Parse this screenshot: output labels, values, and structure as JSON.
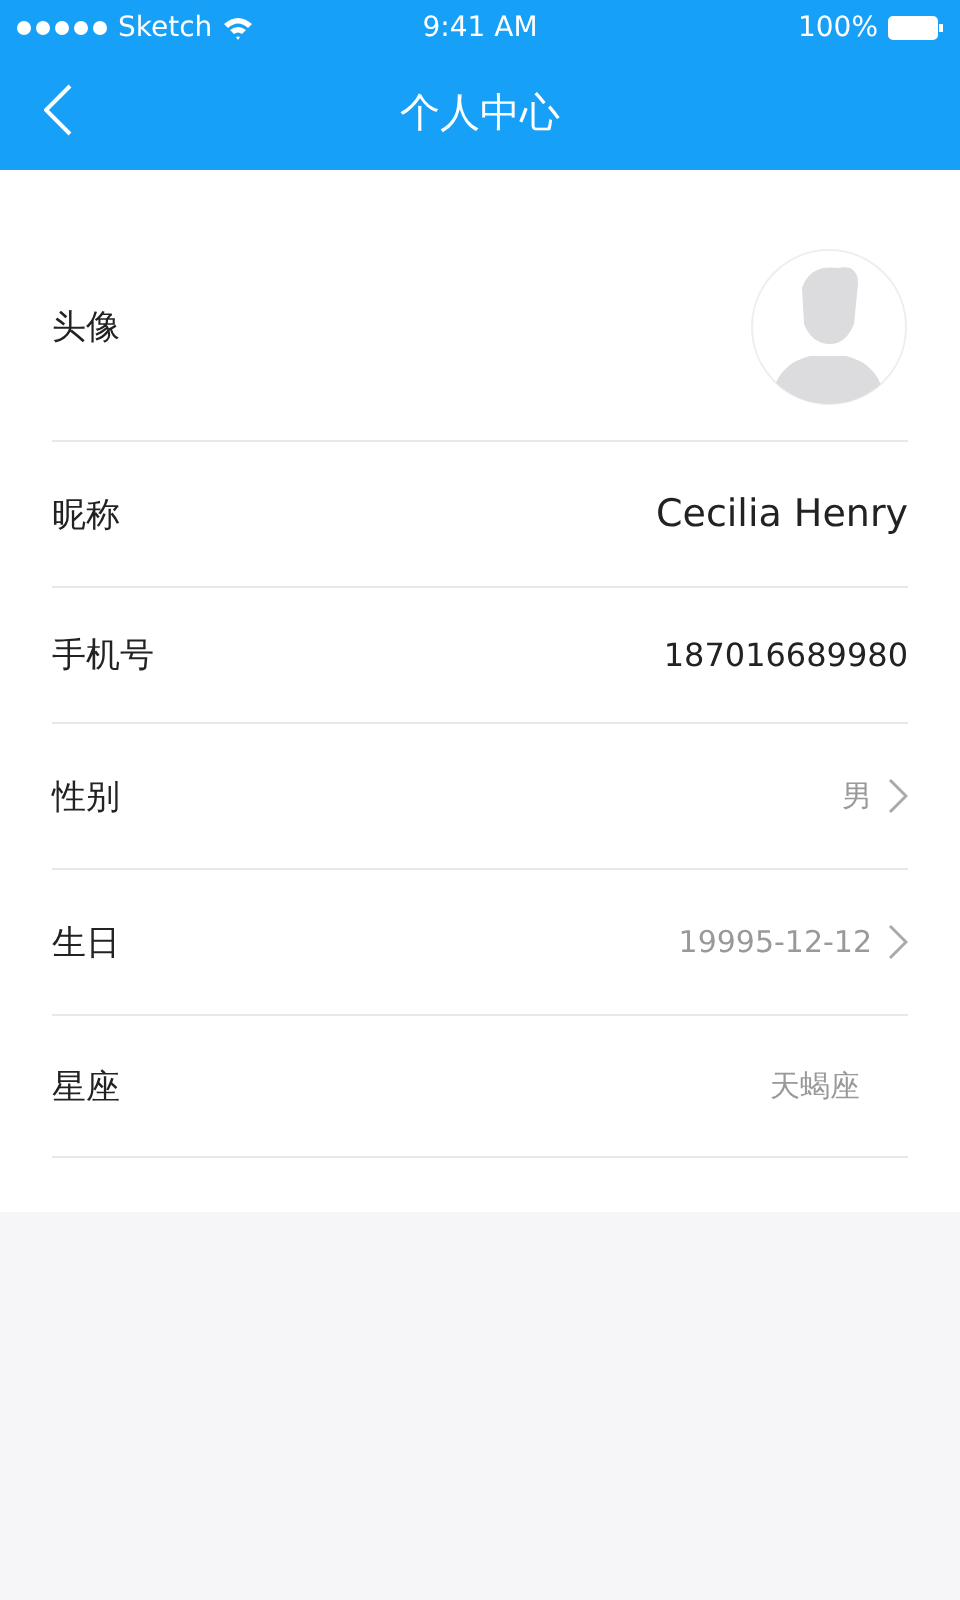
{
  "status_bar": {
    "carrier": "Sketch",
    "time": "9:41 AM",
    "battery": "100%"
  },
  "nav": {
    "title": "个人中心"
  },
  "rows": [
    {
      "kind": "avatar",
      "label": "头像"
    },
    {
      "kind": "name",
      "label": "昵称",
      "value": "Cecilia Henry"
    },
    {
      "kind": "value",
      "label": "手机号",
      "value": "187016689980"
    },
    {
      "kind": "link",
      "label": "性别",
      "value": "男"
    },
    {
      "kind": "link",
      "label": "生日",
      "value": "19995-12-12"
    },
    {
      "kind": "static",
      "label": "星座",
      "value": "天蝎座"
    }
  ]
}
